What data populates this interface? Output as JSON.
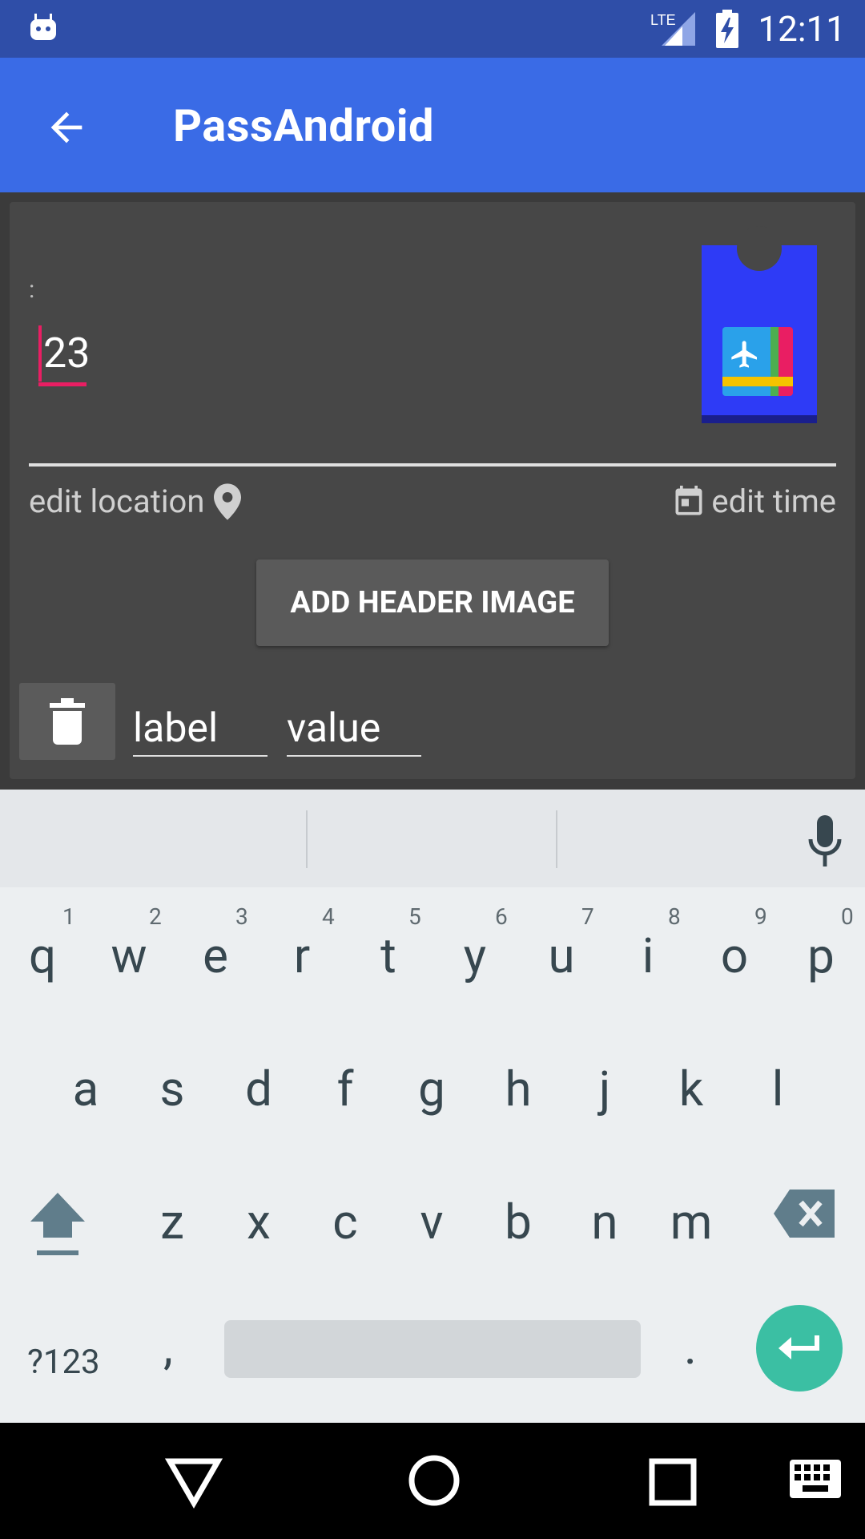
{
  "status_bar": {
    "time": "12:11",
    "network_label": "LTE",
    "left_icon": "android-robot-icon"
  },
  "app_bar": {
    "title": "PassAndroid",
    "back_icon": "arrow-back-icon"
  },
  "editor": {
    "colon_text": ":",
    "value_text": "23",
    "edit_location_label": "edit location",
    "edit_time_label": "edit time",
    "add_header_image_label": "ADD HEADER IMAGE",
    "field_row": {
      "label_placeholder": "label",
      "value_placeholder": "value"
    }
  },
  "keyboard": {
    "row1": [
      "q",
      "w",
      "e",
      "r",
      "t",
      "y",
      "u",
      "i",
      "o",
      "p"
    ],
    "row1_numbers": [
      "1",
      "2",
      "3",
      "4",
      "5",
      "6",
      "7",
      "8",
      "9",
      "0"
    ],
    "row2": [
      "a",
      "s",
      "d",
      "f",
      "g",
      "h",
      "j",
      "k",
      "l"
    ],
    "row3": [
      "z",
      "x",
      "c",
      "v",
      "b",
      "n",
      "m"
    ],
    "symbols_label": "?123",
    "comma": ",",
    "period": "."
  },
  "colors": {
    "status_bar": "#2f4ea8",
    "app_bar": "#3a6be6",
    "accent_pink": "#e91e63",
    "enter_key": "#3bbfa3"
  }
}
